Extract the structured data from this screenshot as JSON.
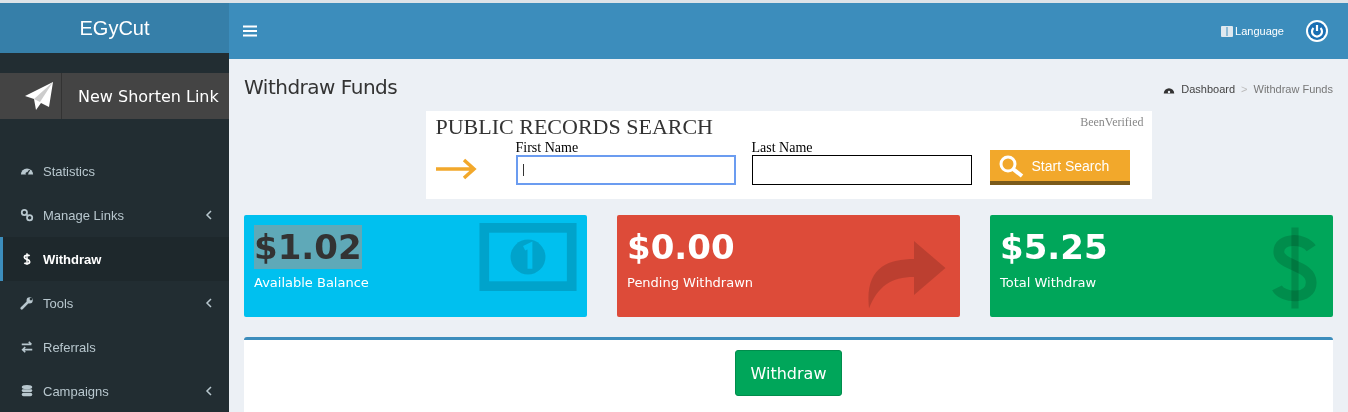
{
  "header": {
    "logo": "EGyCut",
    "language": "Language"
  },
  "sidebar": {
    "new_link_button": "New Shorten Link",
    "items": [
      {
        "label": "Statistics",
        "kind": "gauge",
        "expandable": false,
        "selected": false
      },
      {
        "label": "Manage Links",
        "kind": "link",
        "expandable": true,
        "selected": false
      },
      {
        "label": "Withdraw",
        "kind": "dollar",
        "expandable": false,
        "selected": true
      },
      {
        "label": "Tools",
        "kind": "wrench",
        "expandable": true,
        "selected": false
      },
      {
        "label": "Referrals",
        "kind": "exchange",
        "expandable": false,
        "selected": false
      },
      {
        "label": "Campaigns",
        "kind": "database",
        "expandable": true,
        "selected": false
      }
    ]
  },
  "page": {
    "title": "Withdraw Funds",
    "breadcrumb": [
      "Dashboard",
      "Withdraw Funds"
    ],
    "breadcrumb_separator": ">"
  },
  "ad": {
    "title": "PUBLIC RECORDS SEARCH",
    "brand": "BeenVerified",
    "fields": [
      {
        "label": "First Name",
        "focused": true
      },
      {
        "label": "Last Name",
        "focused": false
      }
    ],
    "button": "Start Search"
  },
  "stats": [
    {
      "amount": "$1.02",
      "label": "Available Balance",
      "color": "#00c0ef",
      "kind": "money",
      "highlighted": true
    },
    {
      "amount": "$0.00",
      "label": "Pending Withdrawn",
      "color": "#dd4b39",
      "kind": "share",
      "highlighted": false
    },
    {
      "amount": "$5.25",
      "label": "Total Withdraw",
      "color": "#00a65a",
      "kind": "dollar",
      "highlighted": false
    }
  ],
  "withdraw_button": "Withdraw"
}
